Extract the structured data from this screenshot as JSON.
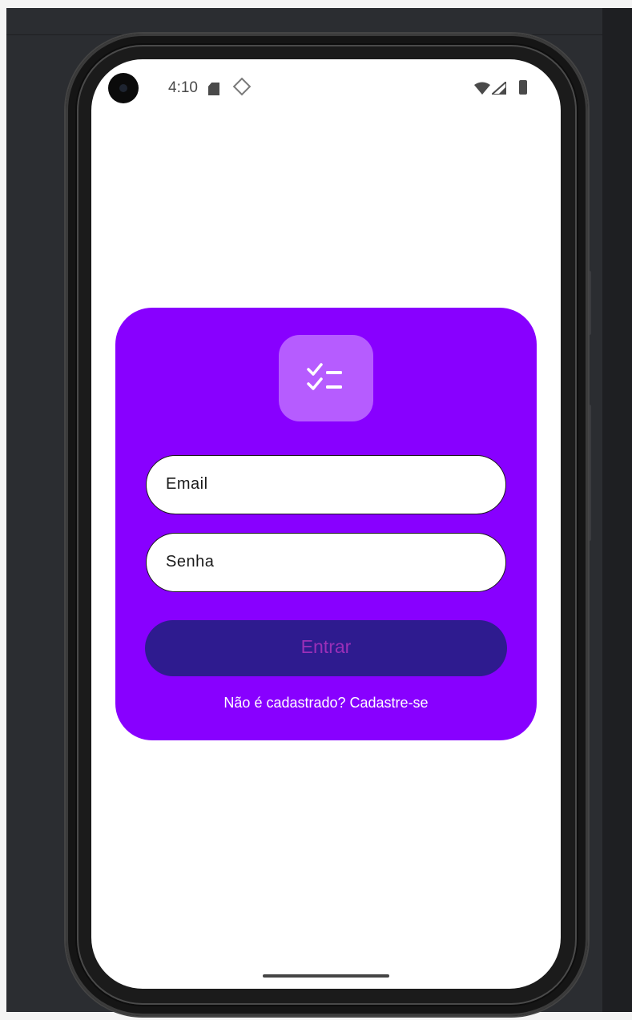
{
  "status_bar": {
    "time": "4:10",
    "icons": [
      "sd-card-icon",
      "diamond-icon",
      "wifi-icon",
      "signal-icon",
      "battery-icon"
    ]
  },
  "login_card": {
    "logo_icon": "checklist-icon",
    "email_placeholder": "Email",
    "password_placeholder": "Senha",
    "submit_label": "Entrar",
    "signup_link": "Não é cadastrado? Cadastre-se"
  },
  "colors": {
    "card": "#8800ff",
    "logo_bg": "#b65cff",
    "button_bg": "#2e1b8f",
    "button_text": "#9b2fb8"
  }
}
